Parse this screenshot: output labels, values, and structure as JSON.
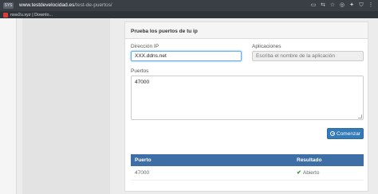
{
  "browser": {
    "site_badge": "SYS",
    "url_domain": "www.testdevelocidad.es",
    "url_path": "/test-de-puertos/",
    "bookmark_label": "nsw2u.xyz | Downlo..."
  },
  "panel": {
    "title": "Prueba los puertos de tu ip",
    "ip_label": "Dirección IP",
    "ip_value": "XXX.ddns.net",
    "apps_label": "Aplicaciones",
    "apps_placeholder": "Escriba el nombre de la aplicación",
    "ports_label": "Puertos",
    "ports_value": "47000",
    "start_button": "Comenzar"
  },
  "results": {
    "columns": [
      "Puerto",
      "Resultado"
    ],
    "rows": [
      {
        "port": "47000",
        "result": "Abierto"
      }
    ]
  },
  "colors": {
    "accent": "#337ab7",
    "table_header": "#3d6fa6",
    "open_status": "#3c8c3c"
  }
}
